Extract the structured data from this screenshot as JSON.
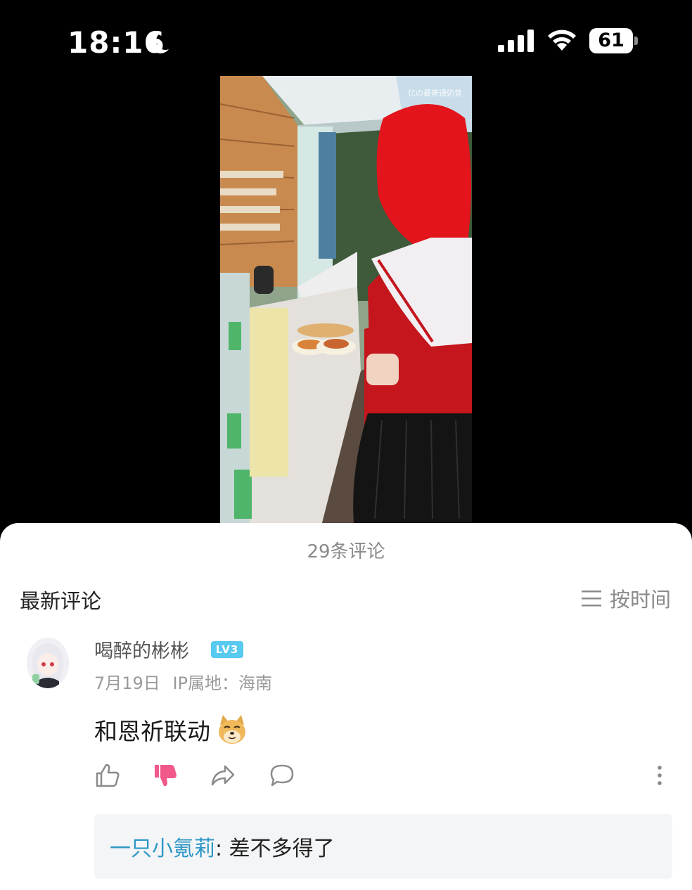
{
  "status_bar": {
    "time": "18:16",
    "battery": "61",
    "icons": [
      "moon-icon",
      "signal-icon",
      "wifi-icon",
      "battery-icon"
    ]
  },
  "video": {
    "watermark": "亿の最普通奶昔"
  },
  "comments": {
    "count_label": "29条评论",
    "section_title": "最新评论",
    "sort_label": "按时间",
    "sort_icon": "list-icon",
    "items": [
      {
        "username": "喝醉的彬彬",
        "level": "LV3",
        "date": "7月19日",
        "ip_location": "IP属地：海南",
        "text": "和恩祈联动",
        "emoji": "doge-icon",
        "actions": [
          "like-icon",
          "dislike-icon",
          "share-icon",
          "reply-icon",
          "more-icon"
        ],
        "dislike_active": true,
        "reply": {
          "user": "一只小氪莉",
          "separator": ": ",
          "text": "差不多得了"
        }
      }
    ]
  },
  "colors": {
    "dislike_active": "#f0598a",
    "reply_user": "#2f97c6",
    "level_badge": "#58c9ef"
  }
}
